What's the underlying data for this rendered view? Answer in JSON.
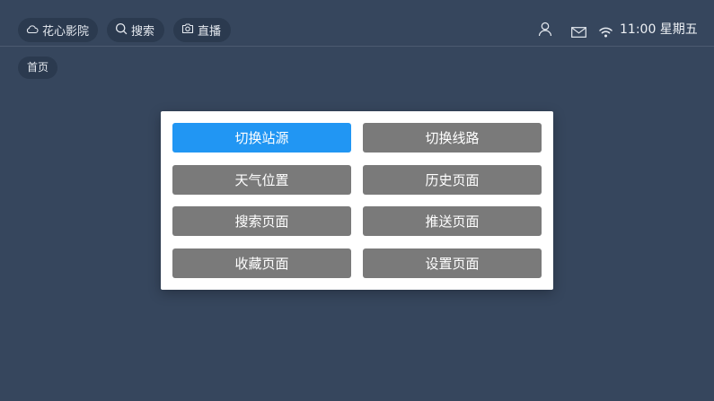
{
  "theme": {
    "background": "#36465d",
    "pill_background": "#2b3a4f",
    "button_gray": "#7a7a7a",
    "button_active": "#2196f3"
  },
  "header": {
    "home_pill": {
      "label": "花心影院",
      "icon": "cloud-icon"
    },
    "search_pill": {
      "label": "搜索",
      "icon": "search-icon"
    },
    "live_pill": {
      "label": "直播",
      "icon": "camera-icon"
    },
    "status": {
      "icons": [
        "user-icon",
        "mail-icon",
        "wifi-icon"
      ],
      "clock": "11:00 星期五"
    }
  },
  "breadcrumb": {
    "label": "首页"
  },
  "menu": {
    "items": [
      {
        "label": "切换站源",
        "active": true
      },
      {
        "label": "切换线路",
        "active": false
      },
      {
        "label": "天气位置",
        "active": false
      },
      {
        "label": "历史页面",
        "active": false
      },
      {
        "label": "搜索页面",
        "active": false
      },
      {
        "label": "推送页面",
        "active": false
      },
      {
        "label": "收藏页面",
        "active": false
      },
      {
        "label": "设置页面",
        "active": false
      }
    ]
  }
}
